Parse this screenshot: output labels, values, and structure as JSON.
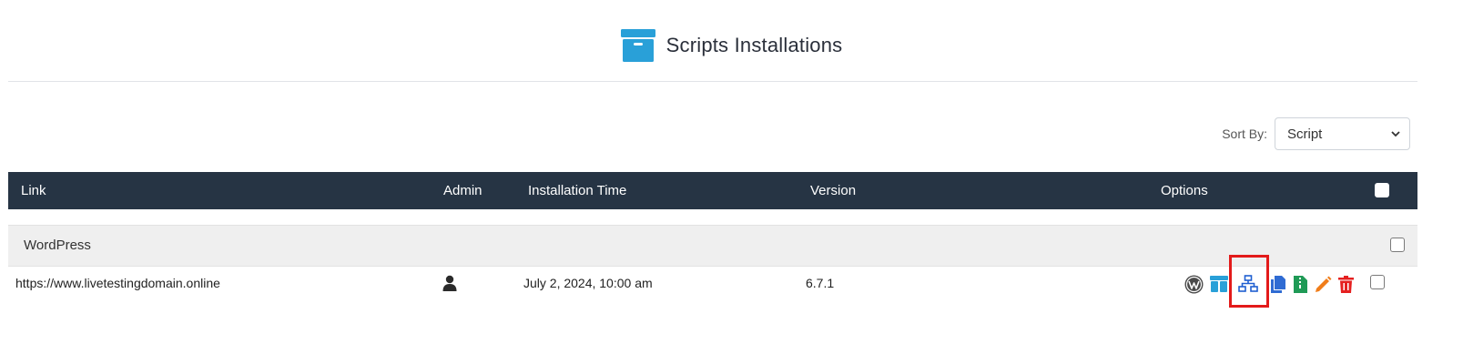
{
  "page": {
    "title": "Scripts Installations"
  },
  "sort": {
    "label": "Sort By:",
    "selected": "Script"
  },
  "table": {
    "headers": {
      "link": "Link",
      "admin": "Admin",
      "installation_time": "Installation Time",
      "version": "Version",
      "options": "Options"
    },
    "groups": [
      {
        "name": "WordPress",
        "rows": [
          {
            "link": "https://www.livetestingdomain.online",
            "installation_time": "July 2, 2024, 10:00 am",
            "version": "6.7.1",
            "options": [
              {
                "icon": "wordpress-icon",
                "color": "#4a4a4a"
              },
              {
                "icon": "archive-box-icon",
                "color": "#29a0d8"
              },
              {
                "icon": "sitemap-icon",
                "color": "#1f5fd1"
              },
              {
                "icon": "copy-icon",
                "color": "#2f6bd3"
              },
              {
                "icon": "zip-file-icon",
                "color": "#1f9a56"
              },
              {
                "icon": "pencil-icon",
                "color": "#f07d1a"
              },
              {
                "icon": "trash-icon",
                "color": "#e52020"
              }
            ]
          }
        ]
      }
    ]
  },
  "colors": {
    "header_bg": "#263444",
    "group_bg": "#efefef",
    "highlight": "#e31a1a",
    "accent": "#29a0d8"
  }
}
